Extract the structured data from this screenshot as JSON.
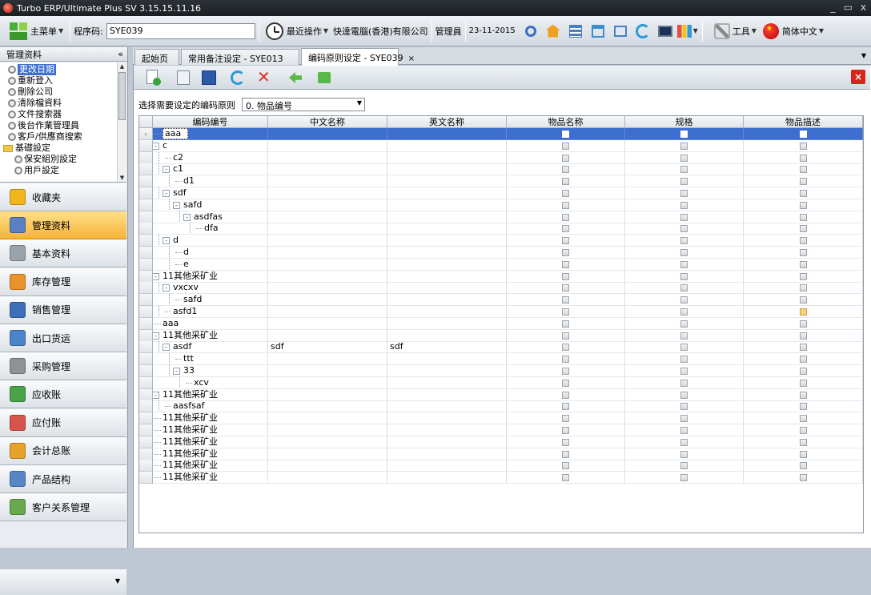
{
  "window": {
    "title": "Turbo ERP/Ultimate Plus SV 3.15.15.11.16",
    "controls": [
      "_",
      "▭",
      "x"
    ]
  },
  "toolbar": {
    "main_menu": "主菜单",
    "program_code_label": "程序码:",
    "program_code_value": "SYE039",
    "recent_ops": "最近操作",
    "company": "快達電腦(香港)有限公司",
    "user": "管理員",
    "date": "23-11-2015",
    "tools": "工具",
    "language": "简体中文"
  },
  "left": {
    "header": "管理资料",
    "collapse": "«",
    "tree": [
      {
        "label": "更改日期",
        "selected": true
      },
      {
        "label": "重新登入"
      },
      {
        "label": "刪除公司"
      },
      {
        "label": "清除檔資料"
      },
      {
        "label": "文件搜索器"
      },
      {
        "label": "後台作業管理員"
      },
      {
        "label": "客戶/供應商搜索"
      },
      {
        "label": "基礎設定",
        "folder": true
      },
      {
        "label": "保安組別設定"
      },
      {
        "label": "用戶設定"
      }
    ],
    "nav": [
      {
        "label": "收藏夹",
        "color": "#f2b51c"
      },
      {
        "label": "管理资料",
        "color": "#5a7fc4",
        "active": true
      },
      {
        "label": "基本资料",
        "color": "#9aa3ab"
      },
      {
        "label": "库存管理",
        "color": "#e8932b"
      },
      {
        "label": "销售管理",
        "color": "#3e6fba"
      },
      {
        "label": "出口货运",
        "color": "#4b84c8"
      },
      {
        "label": "采购管理",
        "color": "#8e9296"
      },
      {
        "label": "应收账",
        "color": "#4aa24a"
      },
      {
        "label": "应付账",
        "color": "#d5554a"
      },
      {
        "label": "会计总账",
        "color": "#e6a22a"
      },
      {
        "label": "产品结构",
        "color": "#5886c4"
      },
      {
        "label": "客户关系管理",
        "color": "#6aa84f"
      }
    ]
  },
  "tabs": [
    {
      "label": "起始页"
    },
    {
      "label": "常用备注设定 - SYE013"
    },
    {
      "label": "编码原则设定 - SYE039",
      "active": true,
      "close": "×"
    }
  ],
  "filter": {
    "label": "选择需要设定的编码原则",
    "value": "0. 物品编号"
  },
  "grid": {
    "columns": [
      "编码编号",
      "中文名称",
      "英文名称",
      "物品名称",
      "规格",
      "物品描述"
    ],
    "rows": [
      {
        "code": "aaa",
        "level": 0,
        "selected": true
      },
      {
        "code": "c",
        "level": 0,
        "exp": "-"
      },
      {
        "code": "c2",
        "level": 1
      },
      {
        "code": "c1",
        "level": 1,
        "exp": "-"
      },
      {
        "code": "d1",
        "level": 2
      },
      {
        "code": "sdf",
        "level": 1,
        "exp": "-"
      },
      {
        "code": "safd",
        "level": 2,
        "exp": "-"
      },
      {
        "code": "asdfas",
        "level": 3,
        "exp": "-"
      },
      {
        "code": "dfa",
        "level": 4
      },
      {
        "code": "d",
        "level": 1,
        "exp": "-"
      },
      {
        "code": "d",
        "level": 2
      },
      {
        "code": "e",
        "level": 2
      },
      {
        "code": "11其他采矿业",
        "level": 0,
        "exp": "-"
      },
      {
        "code": "vxcxv",
        "level": 1,
        "exp": "-"
      },
      {
        "code": "safd",
        "level": 2
      },
      {
        "code": "asfd1",
        "level": 1,
        "desc_on": true
      },
      {
        "code": "aaa",
        "level": 0
      },
      {
        "code": "11其他采矿业",
        "level": 0,
        "exp": "-"
      },
      {
        "code": "asdf",
        "level": 1,
        "exp": "-",
        "cn": "sdf",
        "en": "sdf"
      },
      {
        "code": "ttt",
        "level": 2
      },
      {
        "code": "33",
        "level": 2,
        "exp": "-"
      },
      {
        "code": "xcv",
        "level": 3
      },
      {
        "code": "11其他采矿业",
        "level": 0,
        "exp": "-"
      },
      {
        "code": "aasfsaf",
        "level": 1
      },
      {
        "code": "11其他采矿业",
        "level": 0
      },
      {
        "code": "11其他采矿业",
        "level": 0
      },
      {
        "code": "11其他采矿业",
        "level": 0
      },
      {
        "code": "11其他采矿业",
        "level": 0
      },
      {
        "code": "11其他采矿业",
        "level": 0
      },
      {
        "code": "11其他采矿业",
        "level": 0
      }
    ]
  }
}
